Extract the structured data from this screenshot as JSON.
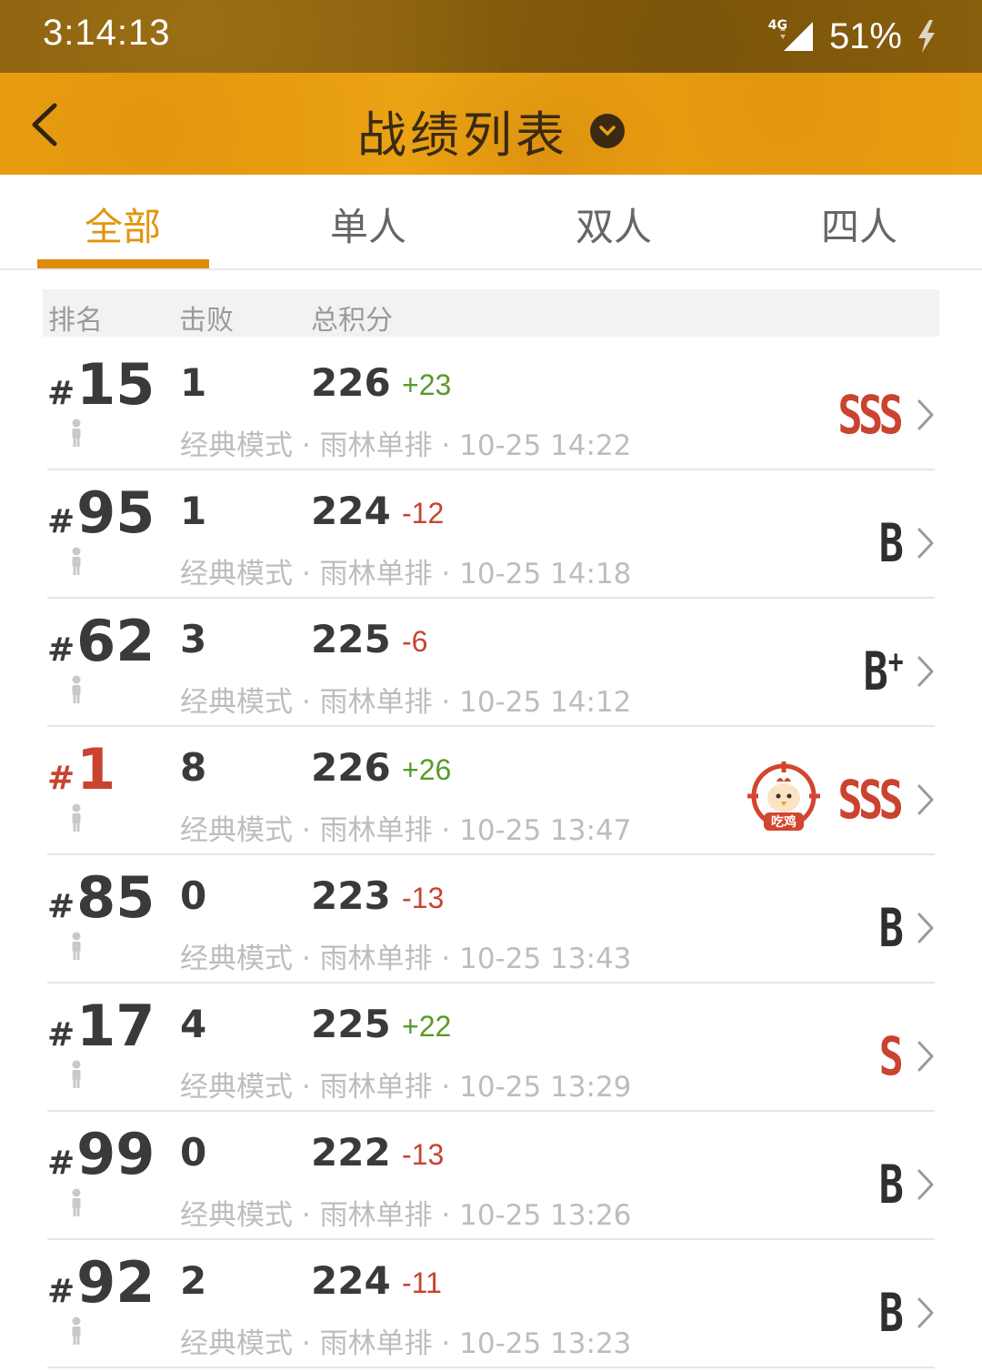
{
  "status": {
    "time": "3:14:13",
    "network": "4G",
    "battery": "51%"
  },
  "header": {
    "title": "战绩列表"
  },
  "tabs": [
    {
      "label": "全部",
      "active": true
    },
    {
      "label": "单人",
      "active": false
    },
    {
      "label": "双人",
      "active": false
    },
    {
      "label": "四人",
      "active": false
    }
  ],
  "columns": {
    "rank": "排名",
    "kills": "击败",
    "score": "总积分"
  },
  "matches": [
    {
      "rank": "15",
      "kills": "1",
      "score": "226",
      "delta": "+23",
      "meta": "经典模式 · 雨林单排 · 10-25 14:22",
      "grade": "SSS",
      "grade_plus": "",
      "winner": false
    },
    {
      "rank": "95",
      "kills": "1",
      "score": "224",
      "delta": "-12",
      "meta": "经典模式 · 雨林单排 · 10-25 14:18",
      "grade": "B",
      "grade_plus": "",
      "winner": false
    },
    {
      "rank": "62",
      "kills": "3",
      "score": "225",
      "delta": "-6",
      "meta": "经典模式 · 雨林单排 · 10-25 14:12",
      "grade": "B",
      "grade_plus": "+",
      "winner": false
    },
    {
      "rank": "1",
      "kills": "8",
      "score": "226",
      "delta": "+26",
      "meta": "经典模式 · 雨林单排 · 10-25 13:47",
      "grade": "SSS",
      "grade_plus": "",
      "winner": true,
      "badge_text": "吃鸡"
    },
    {
      "rank": "85",
      "kills": "0",
      "score": "223",
      "delta": "-13",
      "meta": "经典模式 · 雨林单排 · 10-25 13:43",
      "grade": "B",
      "grade_plus": "",
      "winner": false
    },
    {
      "rank": "17",
      "kills": "4",
      "score": "225",
      "delta": "+22",
      "meta": "经典模式 · 雨林单排 · 10-25 13:29",
      "grade": "S",
      "grade_plus": "",
      "winner": false
    },
    {
      "rank": "99",
      "kills": "0",
      "score": "222",
      "delta": "-13",
      "meta": "经典模式 · 雨林单排 · 10-25 13:26",
      "grade": "B",
      "grade_plus": "",
      "winner": false
    },
    {
      "rank": "92",
      "kills": "2",
      "score": "224",
      "delta": "-11",
      "meta": "经典模式 · 雨林单排 · 10-25 13:23",
      "grade": "B",
      "grade_plus": "",
      "winner": false
    }
  ],
  "colors": {
    "accent": "#eba213",
    "positive": "#5a9a2a",
    "negative": "#c9432f"
  }
}
